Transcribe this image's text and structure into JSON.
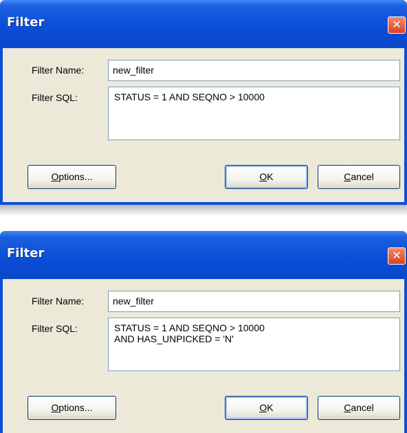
{
  "dialogs": [
    {
      "title": "Filter",
      "close_glyph": "✕",
      "filter_name_label": "Filter Name:",
      "filter_name_value": "new_filter",
      "filter_sql_label": "Filter SQL:",
      "filter_sql_value": "STATUS = 1 AND SEQNO > 10000",
      "options_label": {
        "mnemonic": "O",
        "rest": "ptions..."
      },
      "ok_label": {
        "mnemonic": "O",
        "rest": "K"
      },
      "cancel_label": {
        "mnemonic": "C",
        "rest": "ancel"
      }
    },
    {
      "title": "Filter",
      "close_glyph": "✕",
      "filter_name_label": "Filter Name:",
      "filter_name_value": "new_filter",
      "filter_sql_label": "Filter SQL:",
      "filter_sql_value": "STATUS = 1 AND SEQNO > 10000\nAND HAS_UNPICKED = 'N'",
      "options_label": {
        "mnemonic": "O",
        "rest": "ptions..."
      },
      "ok_label": {
        "mnemonic": "O",
        "rest": "K"
      },
      "cancel_label": {
        "mnemonic": "C",
        "rest": "ancel"
      }
    }
  ],
  "colors": {
    "title_bar": "#0a4fd8",
    "client_background": "#ece9d8",
    "close_button": "#d8421f",
    "field_border": "#7f9db9"
  }
}
